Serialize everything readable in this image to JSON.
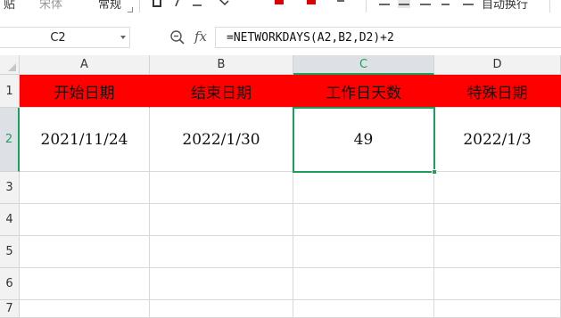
{
  "toolbar": {
    "item1": "贴",
    "item2": "宋体",
    "item3": "常规",
    "item4": "自动换行"
  },
  "formula_bar": {
    "name_box": "C2",
    "fx_label": "fx",
    "formula": "=NETWORKDAYS(A2,B2,D2)+2"
  },
  "columns": [
    "A",
    "B",
    "C",
    "D"
  ],
  "rows": [
    "1",
    "2",
    "3",
    "4",
    "5",
    "6",
    "7"
  ],
  "active_cell": {
    "column": "C",
    "row": "2"
  },
  "cells": {
    "A1": "开始日期",
    "B1": "结束日期",
    "C1": "工作日天数",
    "D1": "特殊日期",
    "A2": "2021/11/24",
    "B2": "2022/1/30",
    "C2": "49",
    "D2": "2022/1/3"
  },
  "colors": {
    "header_fill": "#ff0000",
    "selection": "#1e9e5b"
  }
}
